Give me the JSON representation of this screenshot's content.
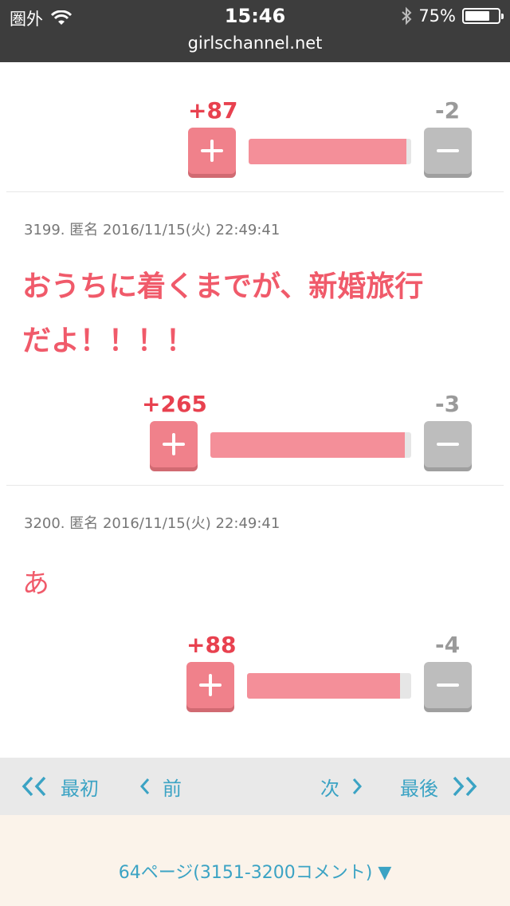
{
  "status_bar": {
    "carrier": "圏外",
    "time": "15:46",
    "battery": "75%",
    "battery_level": 0.75,
    "url": "girlschannel.net"
  },
  "comments": [
    {
      "plus": "+87",
      "minus": "-2",
      "ratio": 0.97
    },
    {
      "meta": "3199. 匿名 2016/11/15(火) 22:49:41",
      "text_line1": "おうちに着くまでが、新婚旅行",
      "text_line2": "だよ！！！！",
      "plus": "+265",
      "minus": "-3",
      "ratio": 0.97
    },
    {
      "meta": "3200. 匿名 2016/11/15(火) 22:49:41",
      "text": "あ",
      "plus": "+88",
      "minus": "-4",
      "ratio": 0.93
    }
  ],
  "pager": {
    "first": "最初",
    "prev": "前",
    "next": "次",
    "last": "最後"
  },
  "page_select": {
    "label": "64ページ(3151-3200コメント) ▼"
  },
  "colors": {
    "plus": "#e8414f",
    "bar_fill": "#f48f99",
    "link": "#3ba3c4"
  }
}
